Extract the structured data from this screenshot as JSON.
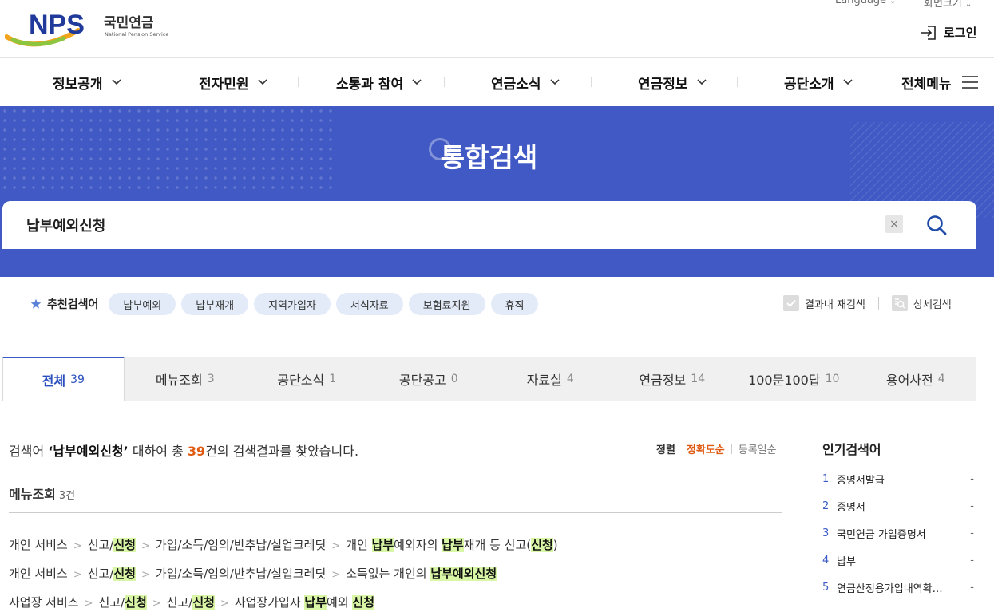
{
  "header": {
    "logo_text": "NPS",
    "logo_korean": "국민연금",
    "logo_english": "National Pension Service",
    "language_label": "Language",
    "zoom_label": "화면크기",
    "login_label": "로그인"
  },
  "gnb": {
    "items": [
      {
        "label": "정보공개"
      },
      {
        "label": "전자민원"
      },
      {
        "label": "소통과 참여"
      },
      {
        "label": "연금소식"
      },
      {
        "label": "연금정보"
      },
      {
        "label": "공단소개"
      }
    ],
    "all_menu_label": "전체메뉴"
  },
  "banner": {
    "title": "통합검색",
    "search_value": "납부예외신청",
    "clear_glyph": "×"
  },
  "recommend": {
    "label": "추천검색어",
    "chips": [
      "납부예외",
      "납부재개",
      "지역가입자",
      "서식자료",
      "보험료지원",
      "휴직"
    ],
    "research_label": "결과내 재검색",
    "detail_label": "상세검색"
  },
  "tabs": [
    {
      "label": "전체",
      "count": "39",
      "active": true
    },
    {
      "label": "메뉴조회",
      "count": "3"
    },
    {
      "label": "공단소식",
      "count": "1"
    },
    {
      "label": "공단공고",
      "count": "0"
    },
    {
      "label": "자료실",
      "count": "4"
    },
    {
      "label": "연금정보",
      "count": "14"
    },
    {
      "label": "100문100답",
      "count": "10"
    },
    {
      "label": "용어사전",
      "count": "4"
    }
  ],
  "results": {
    "summary_prefix": "검색어 ",
    "summary_term": "‘납부예외신청’",
    "summary_mid": " 대하여 총 ",
    "summary_count": "39",
    "summary_suffix": "건의 검색결과를 찾았습니다.",
    "sort_label": "정렬",
    "sort_options": [
      "정확도순",
      "등록일순"
    ],
    "section_title": "메뉴조회",
    "section_count": "3건",
    "rows": [
      {
        "segments": [
          [
            {
              "t": "개인 서비스"
            }
          ],
          [
            {
              "t": "신고/"
            },
            {
              "t": "신청",
              "hl": true
            }
          ],
          [
            {
              "t": "가입/소득/임의/반추납/실업크레딧"
            }
          ],
          [
            {
              "t": "개인 "
            },
            {
              "t": "납부",
              "hl": true
            },
            {
              "t": "예외자의 "
            },
            {
              "t": "납부",
              "hl": true
            },
            {
              "t": "재개 등 신고("
            },
            {
              "t": "신청",
              "hl": true
            },
            {
              "t": ")"
            }
          ]
        ]
      },
      {
        "segments": [
          [
            {
              "t": "개인 서비스"
            }
          ],
          [
            {
              "t": "신고/"
            },
            {
              "t": "신청",
              "hl": true
            }
          ],
          [
            {
              "t": "가입/소득/임의/반추납/실업크레딧"
            }
          ],
          [
            {
              "t": "소득없는 개인의 "
            },
            {
              "t": "납부예외신청",
              "hl": true
            }
          ]
        ]
      },
      {
        "segments": [
          [
            {
              "t": "사업장 서비스"
            }
          ],
          [
            {
              "t": "신고/"
            },
            {
              "t": "신청",
              "hl": true
            }
          ],
          [
            {
              "t": "신고/"
            },
            {
              "t": "신청",
              "hl": true
            }
          ],
          [
            {
              "t": "사업장가입자 "
            },
            {
              "t": "납부",
              "hl": true
            },
            {
              "t": "예외 "
            },
            {
              "t": "신청",
              "hl": true
            }
          ]
        ]
      }
    ],
    "path_separator": ">"
  },
  "popular": {
    "title": "인기검색어",
    "items": [
      {
        "rank": "1",
        "keyword": "증명서발급",
        "change": "-"
      },
      {
        "rank": "2",
        "keyword": "증명서",
        "change": "-"
      },
      {
        "rank": "3",
        "keyword": "국민연금 가입증명서",
        "change": "-"
      },
      {
        "rank": "4",
        "keyword": "납부",
        "change": "-"
      },
      {
        "rank": "5",
        "keyword": "연금산정용가입내역확…",
        "change": "-"
      }
    ]
  },
  "colors": {
    "banner": "#4159c4",
    "accent_blue": "#2c4fbf",
    "accent_orange": "#e05a12",
    "highlight": "#d9f5a6"
  }
}
